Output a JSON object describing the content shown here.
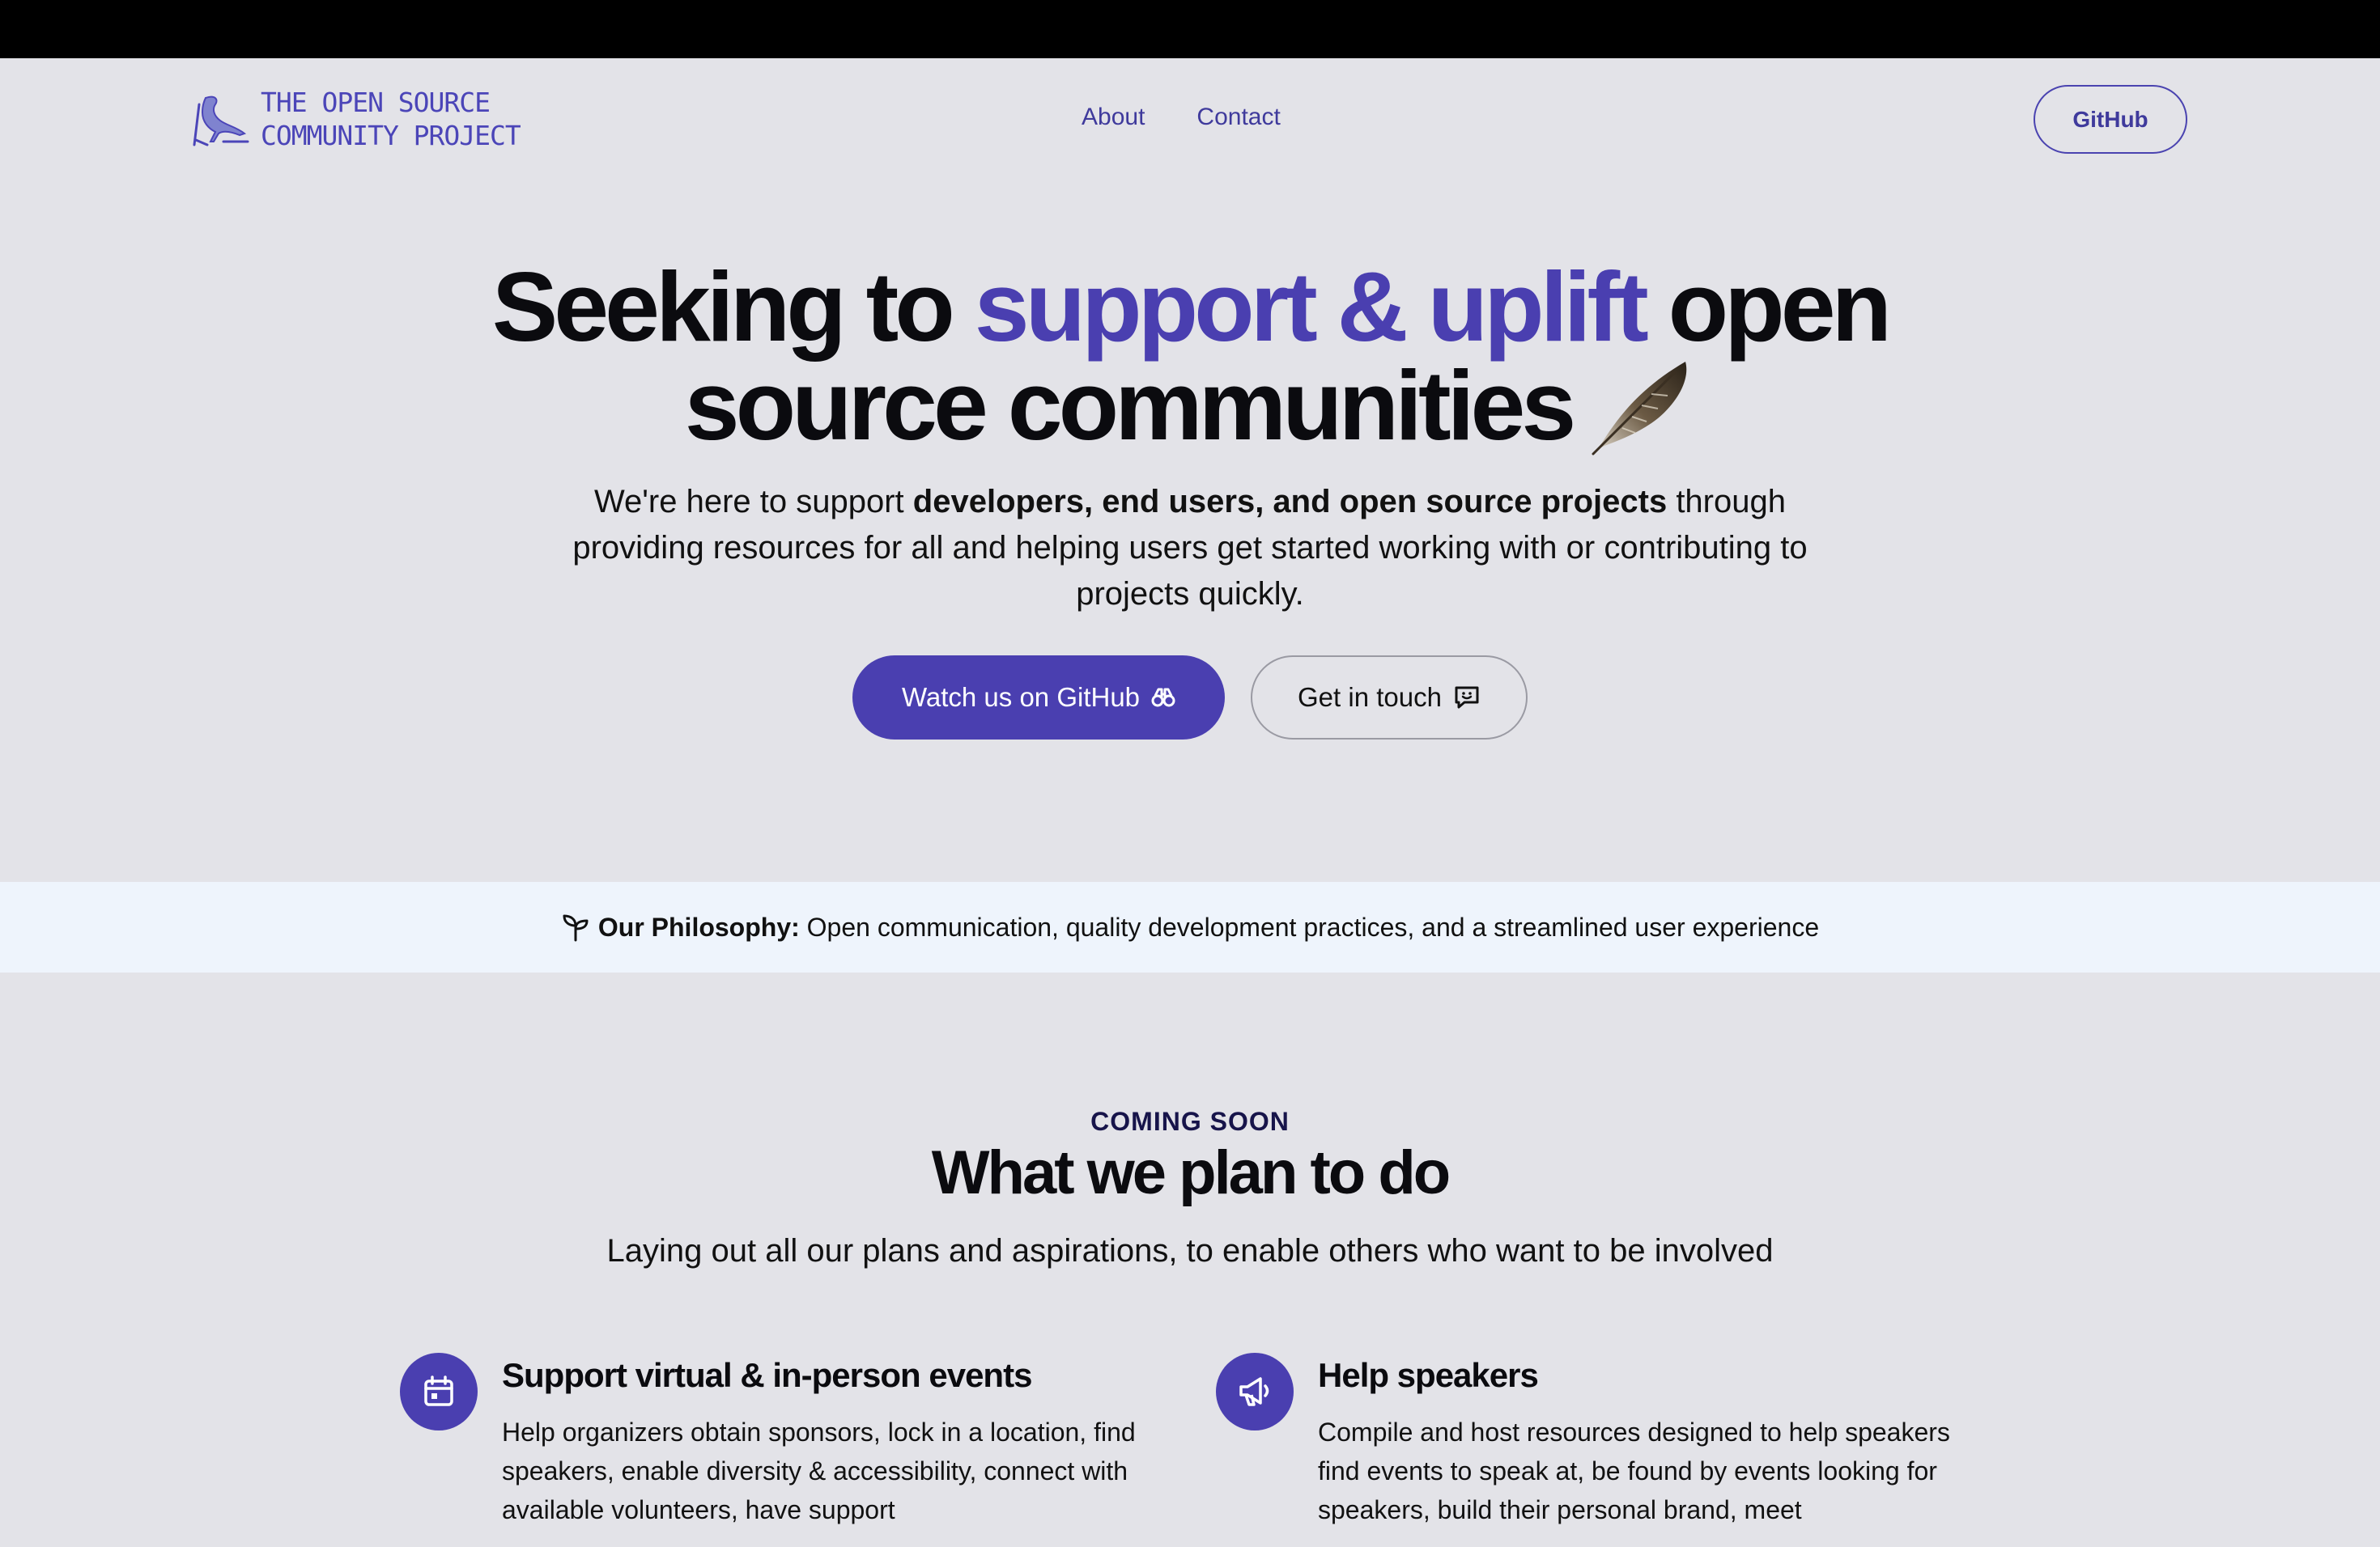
{
  "header": {
    "logo_line1": "The Open Source",
    "logo_line2": "Community Project",
    "nav": [
      {
        "label": "About"
      },
      {
        "label": "Contact"
      }
    ],
    "github_button": "GitHub"
  },
  "hero": {
    "title_part1": "Seeking to ",
    "title_accent": "support & uplift",
    "title_part2": " open source communities",
    "sub_part1": "We're here to support ",
    "sub_bold": "developers, end users, and open source projects",
    "sub_part2": " through providing resources for all and helping users get started working with or contributing to projects quickly.",
    "primary_button": "Watch us on GitHub",
    "secondary_button": "Get in touch"
  },
  "philosophy": {
    "label": "Our Philosophy:",
    "text": " Open communication, quality development practices, and a streamlined user experience"
  },
  "plans": {
    "eyebrow": "COMING SOON",
    "title": "What we plan to do",
    "subtitle": "Laying out all our plans and aspirations, to enable others who want to be involved",
    "features": [
      {
        "icon": "calendar-icon",
        "title": "Support virtual & in-person events",
        "text": "Help organizers obtain sponsors, lock in a location, find speakers, enable diversity & accessibility, connect with available volunteers, have support"
      },
      {
        "icon": "megaphone-icon",
        "title": "Help speakers",
        "text": "Compile and host resources designed to help speakers find events to speak at, be found by events looking for speakers, build their personal brand, meet"
      }
    ]
  },
  "colors": {
    "accent": "#4a3fb0",
    "background": "#e3e3e8",
    "band": "#eef4fc"
  }
}
